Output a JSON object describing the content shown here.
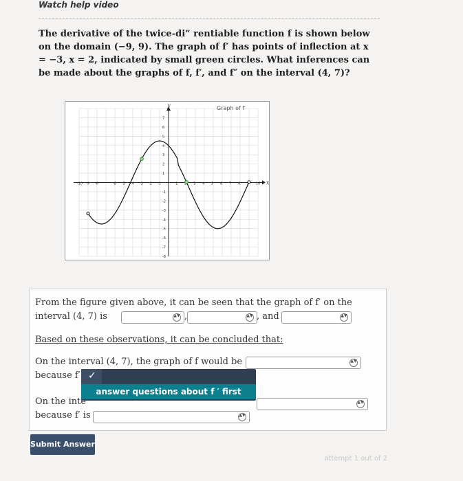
{
  "header": {
    "watch_help": "Watch help video"
  },
  "question": {
    "text": "The derivative of the twice-di” rentiable function f is shown below on the domain (−9, 9). The graph of f′ has points of inflection at x = −3, x = 2, indicated by small green circles. What inferences can be made about the graphs of f, f′, and f″ on the interval (4, 7)?"
  },
  "graph": {
    "title": "Graph of f′",
    "y_axis_label": "y",
    "x_axis_label": "x",
    "x_ticks": [
      "-10",
      "-9",
      "-8",
      "-6",
      "-5",
      "-4",
      "-3",
      "-2",
      "-1",
      "1",
      "2",
      "3",
      "4",
      "5",
      "6",
      "7",
      "8",
      "9",
      "10"
    ],
    "y_ticks": [
      "7",
      "6",
      "5",
      "4",
      "3",
      "2",
      "1",
      "-1",
      "-2",
      "-3",
      "-4",
      "-5",
      "-6",
      "-7",
      "-8"
    ]
  },
  "answer_box": {
    "line1": "From the figure given above, it can be seen that the graph of f′ on the",
    "line2_prefix": "interval (4, 7) is",
    "line2_sep": ",",
    "line2_and": ", and",
    "observations_heading": "Based on these observations, it can be concluded that:",
    "line3_prefix": "On the interval (4, 7), the graph of f would be",
    "line4_prefix": "because f′",
    "line5_prefix": "On the inte",
    "line6_prefix": "because f′ is"
  },
  "tooltip": {
    "check": "✓",
    "message": "answer questions about f ′ first"
  },
  "buttons": {
    "submit": "Submit Answer"
  },
  "status": {
    "attempt": "attempt 1 out of 2"
  }
}
